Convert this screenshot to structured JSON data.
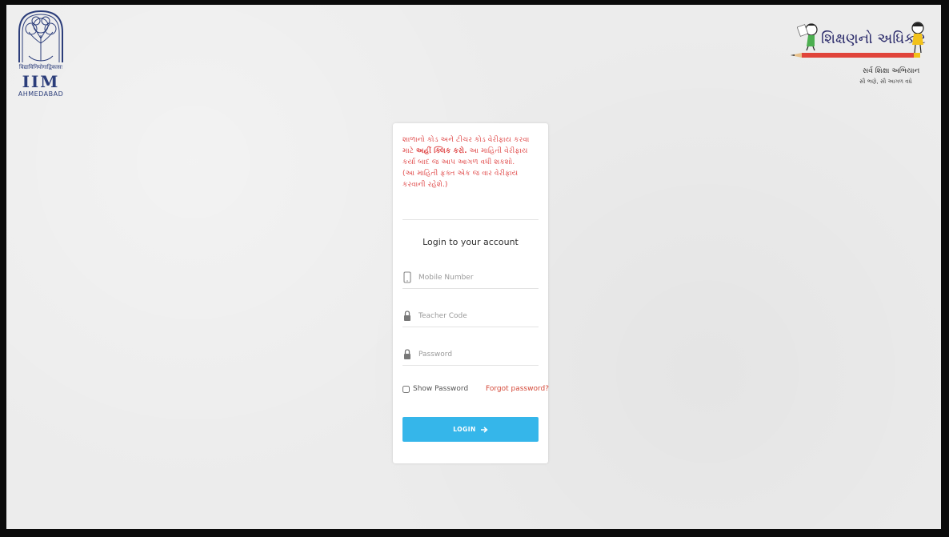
{
  "logos": {
    "iim": {
      "top_text": "विद्याविनियोगाद्विकासः",
      "letters": "IIM",
      "city": "AHMEDABAD"
    },
    "ssa": {
      "title": "શિક્ષણનો અધિકાર",
      "subtitle": "સર્વ શિક્ષા અભિયાન",
      "tagline": "સૌ ભણે, સૌ આગળ વધે"
    }
  },
  "notice": {
    "line1": "શાળાનો કોડ અને ટીચર કોડ વેરીફાય કરવા માટે",
    "link": "અહીં ક્લિક કરો.",
    "line2": " આ માહિતી વેરીફાય કર્યા બાદ જ આપ આગળ વધી શકશો.",
    "line3": "(આ માહિતી ફક્ત એક જ વાર વેરીફાય કરવાની રહેશે.)"
  },
  "login": {
    "title": "Login to your account",
    "mobile_placeholder": "Mobile Number",
    "teacher_placeholder": "Teacher Code",
    "password_placeholder": "Password",
    "show_password": "Show Password",
    "forgot": "Forgot password?",
    "button": "LOGIN",
    "button_icon": "arrow-right-icon"
  },
  "colors": {
    "notice_red": "#e04a4a",
    "button_blue": "#35b6ea",
    "forgot_red": "#d44a3a",
    "iim_blue": "#2b3d7a"
  }
}
